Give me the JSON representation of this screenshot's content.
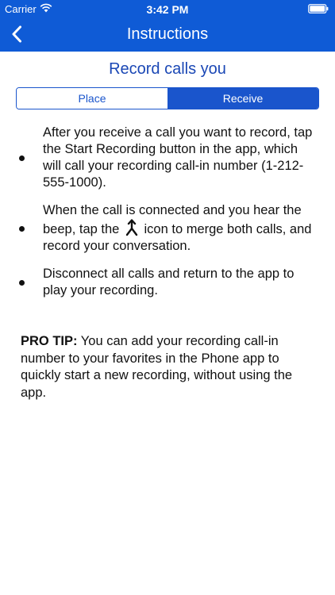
{
  "status": {
    "carrier": "Carrier",
    "time": "3:42 PM"
  },
  "nav": {
    "title": "Instructions",
    "back_icon": "chevron-left-icon"
  },
  "heading": "Record calls you",
  "segments": {
    "place": "Place",
    "receive": "Receive",
    "selected": "Receive"
  },
  "bullets": {
    "item1": "After you receive a call you want to record, tap the Start Recording button in the app, which will call your recording call-in number (1-212-555-1000).",
    "item2_before": "When the call is connected and you hear the beep, tap the ",
    "item2_after": " icon to merge both calls, and record your conversation.",
    "item3": "Disconnect all calls and return to the app to play your recording."
  },
  "protip": {
    "label": "PRO TIP:",
    "text": " You can add your recording call-in number to your favorites in the Phone app to quickly start a new recording, without using the app."
  },
  "colors": {
    "brand": "#0f5bd6",
    "accent": "#1a55cc",
    "heading": "#1a47b5"
  }
}
